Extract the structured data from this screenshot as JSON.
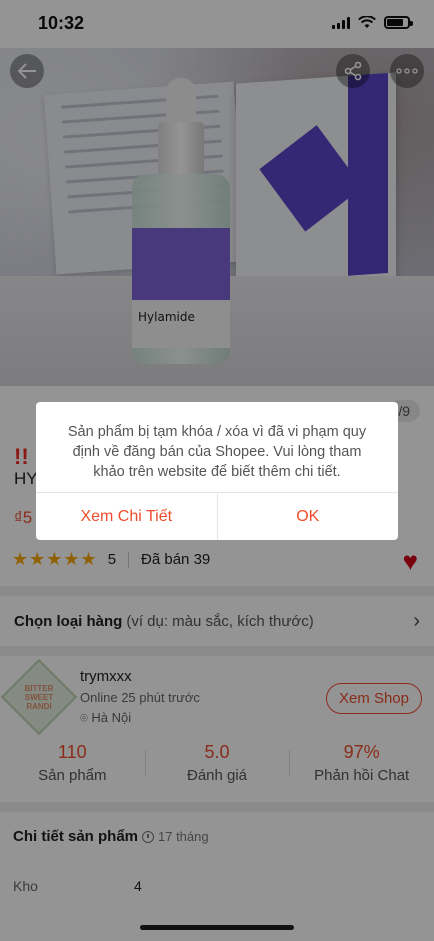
{
  "status_bar": {
    "time": "10:32"
  },
  "hero": {
    "brand_text": "Hylamide",
    "image_counter": "/9"
  },
  "product": {
    "flag": "!!",
    "title_prefix": "HY",
    "price_prefix": "₫5",
    "rating_stars": "★★★★★",
    "rating_value": "5",
    "sold_label": "Đã bán 39"
  },
  "variation": {
    "label": "Chọn loại hàng",
    "hint": "(ví dụ: màu sắc, kích thước)"
  },
  "shop": {
    "logo_text": "BITTER SWEET RANDI",
    "name": "trymxxx",
    "online": "Online 25 phút trước",
    "location": "Hà Nội",
    "view_button": "Xem Shop",
    "stats": [
      {
        "value": "110",
        "label": "Sản phẩm"
      },
      {
        "value": "5.0",
        "label": "Đánh giá"
      },
      {
        "value": "97%",
        "label": "Phản hồi Chat"
      }
    ]
  },
  "detail": {
    "heading": "Chi tiết sản phẩm",
    "time": "17 tháng",
    "rows": [
      {
        "label": "Kho",
        "value": "4"
      }
    ]
  },
  "dialog": {
    "message": "Sản phẩm bị tạm khóa / xóa vì đã vi phạm quy định về đăng bán của Shopee. Vui lòng tham khảo trên website để biết thêm chi tiết.",
    "detail_button": "Xem Chi Tiết",
    "ok_button": "OK"
  },
  "colors": {
    "accent": "#ee4d2d",
    "star": "#f6a700",
    "heart": "#d0011b"
  }
}
